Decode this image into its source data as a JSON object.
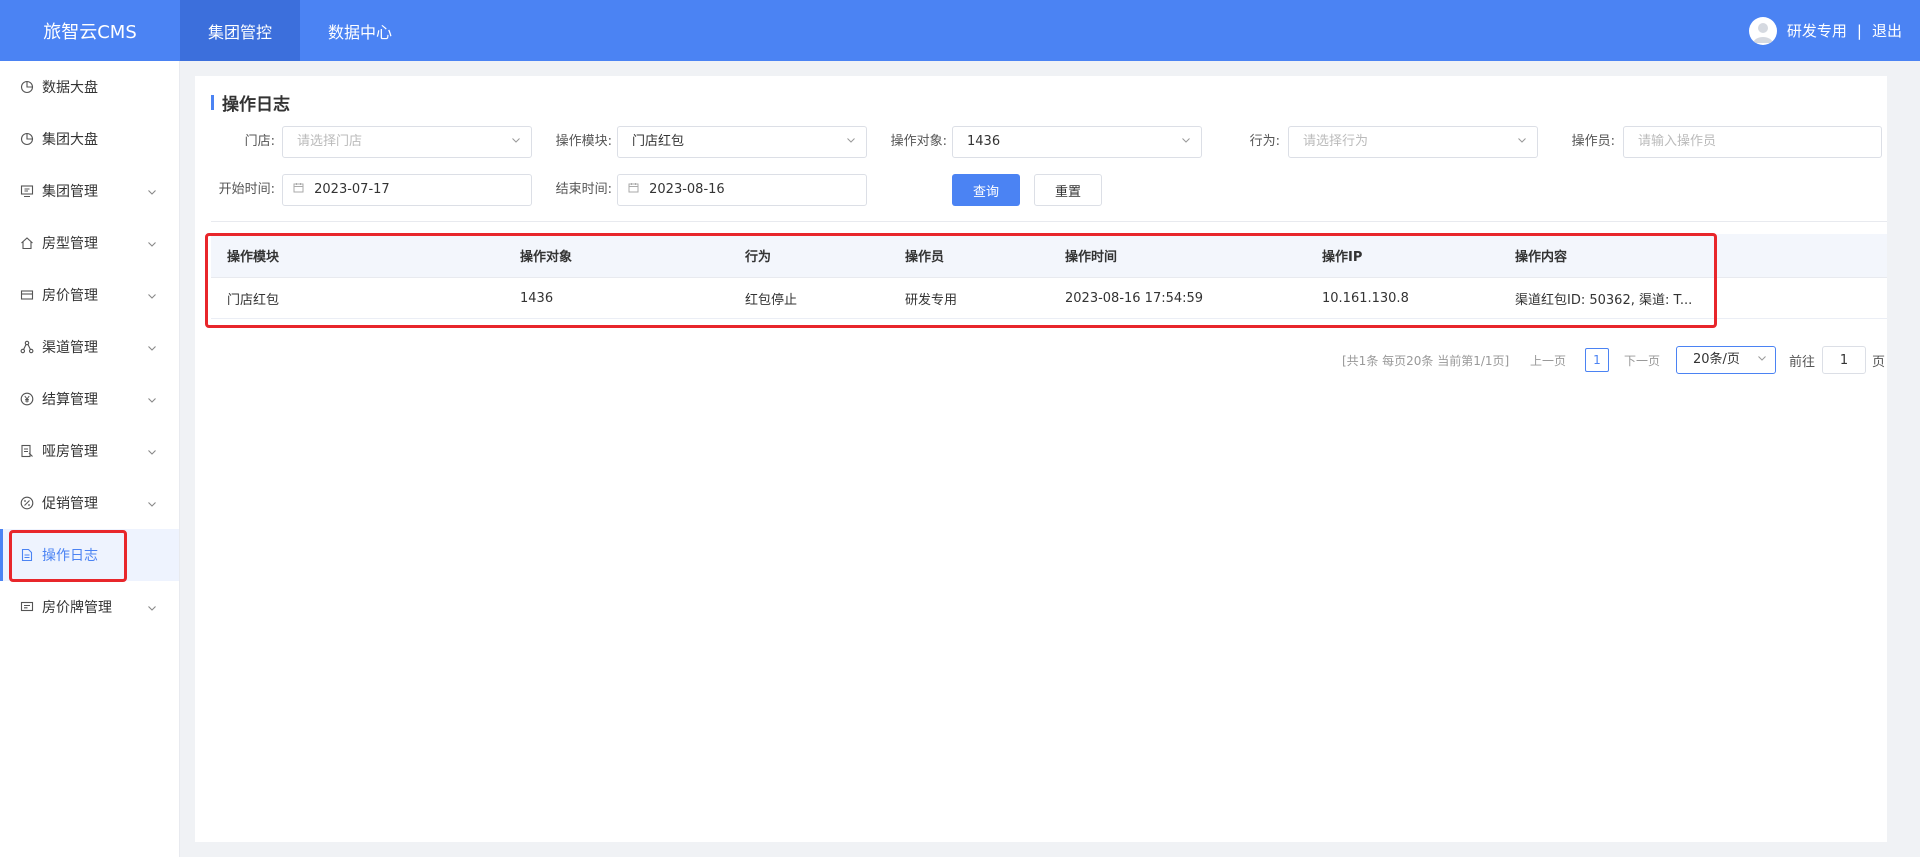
{
  "header": {
    "logo": "旅智云CMS",
    "tabs": [
      {
        "label": "集团管控",
        "active": true
      },
      {
        "label": "数据中心",
        "active": false
      }
    ],
    "user_name": "研发专用",
    "separator": "|",
    "logout": "退出"
  },
  "sidebar": {
    "items": [
      {
        "label": "数据大盘",
        "icon": "pie-chart-icon",
        "has_children": false
      },
      {
        "label": "集团大盘",
        "icon": "pie-chart-icon",
        "has_children": false
      },
      {
        "label": "集团管理",
        "icon": "monitor-icon",
        "has_children": true
      },
      {
        "label": "房型管理",
        "icon": "home-icon",
        "has_children": true
      },
      {
        "label": "房价管理",
        "icon": "wallet-icon",
        "has_children": true
      },
      {
        "label": "渠道管理",
        "icon": "share-icon",
        "has_children": true
      },
      {
        "label": "结算管理",
        "icon": "yen-icon",
        "has_children": true
      },
      {
        "label": "哑房管理",
        "icon": "document-icon",
        "has_children": true
      },
      {
        "label": "促销管理",
        "icon": "sale-icon",
        "has_children": true
      },
      {
        "label": "操作日志",
        "icon": "file-icon",
        "has_children": false,
        "active": true
      },
      {
        "label": "房价牌管理",
        "icon": "board-icon",
        "has_children": true
      }
    ]
  },
  "page": {
    "title": "操作日志"
  },
  "filters": {
    "store_label": "门店:",
    "store_placeholder": "请选择门店",
    "module_label": "操作模块:",
    "module_value": "门店红包",
    "target_label": "操作对象:",
    "target_value": "1436",
    "action_label": "行为:",
    "action_placeholder": "请选择行为",
    "operator_label": "操作员:",
    "operator_placeholder": "请输入操作员",
    "start_label": "开始时间:",
    "start_value": "2023-07-17",
    "end_label": "结束时间:",
    "end_value": "2023-08-16",
    "query_button": "查询",
    "reset_button": "重置"
  },
  "table": {
    "columns": [
      "操作模块",
      "操作对象",
      "行为",
      "操作员",
      "操作时间",
      "操作IP",
      "操作内容"
    ],
    "rows": [
      [
        "门店红包",
        "1436",
        "红包停止",
        "研发专用",
        "2023-08-16 17:54:59",
        "10.161.130.8",
        "渠道红包ID: 50362, 渠道: T..."
      ]
    ]
  },
  "pagination": {
    "summary": "[共1条 每页20条 当前第1/1页]",
    "prev": "上一页",
    "current_page": "1",
    "next": "下一页",
    "page_size": "20条/页",
    "goto_label": "前往",
    "goto_value": "1",
    "page_unit": "页"
  },
  "colors": {
    "primary": "#4b83f3",
    "header_active": "#3c6fdc",
    "highlight_box": "#e8262b"
  }
}
